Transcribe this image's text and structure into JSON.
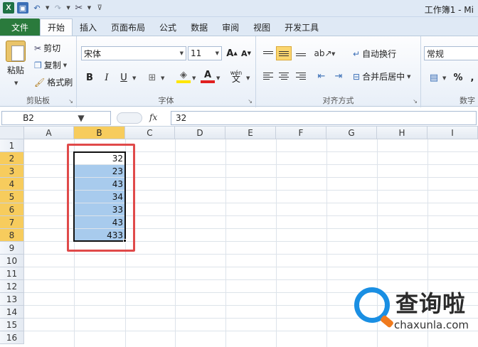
{
  "window": {
    "title": "工作簿1 - Mi"
  },
  "qat": {
    "excel_logo": "X",
    "undo_icon": "↶",
    "redo_icon": "↷"
  },
  "tabs": [
    {
      "label": "文件"
    },
    {
      "label": "开始"
    },
    {
      "label": "插入"
    },
    {
      "label": "页面布局"
    },
    {
      "label": "公式"
    },
    {
      "label": "数据"
    },
    {
      "label": "审阅"
    },
    {
      "label": "视图"
    },
    {
      "label": "开发工具"
    }
  ],
  "ribbon": {
    "clipboard": {
      "paste": "粘贴",
      "cut": "剪切",
      "copy": "复制",
      "format_painter": "格式刷",
      "label": "剪贴板"
    },
    "font": {
      "name": "宋体",
      "size": "11",
      "grow": "A",
      "shrink": "A",
      "bold": "B",
      "italic": "I",
      "underline": "U",
      "font_color": "A",
      "wen": "wén",
      "label": "字体"
    },
    "alignment": {
      "wrap": "自动换行",
      "merge": "合并后居中",
      "label": "对齐方式"
    },
    "number": {
      "format": "常规",
      "percent": "%",
      "label": "数字"
    }
  },
  "formula_bar": {
    "name_box": "B2",
    "fx": "fx",
    "value": "32"
  },
  "columns": [
    "A",
    "B",
    "C",
    "D",
    "E",
    "F",
    "G",
    "H",
    "I"
  ],
  "rows": [
    "1",
    "2",
    "3",
    "4",
    "5",
    "6",
    "7",
    "8",
    "9",
    "10",
    "11",
    "12",
    "13",
    "14",
    "15",
    "16"
  ],
  "cells": {
    "B2": "32",
    "B3": "23",
    "B4": "43",
    "B5": "34",
    "B6": "33",
    "B7": "43",
    "B8": "433"
  },
  "colors": {
    "selection": "#a8cbed",
    "header_selected": "#f7cc5d",
    "annotation": "#e04a4a"
  },
  "watermark": {
    "text": "查询啦",
    "url": "chaxunla.com"
  }
}
